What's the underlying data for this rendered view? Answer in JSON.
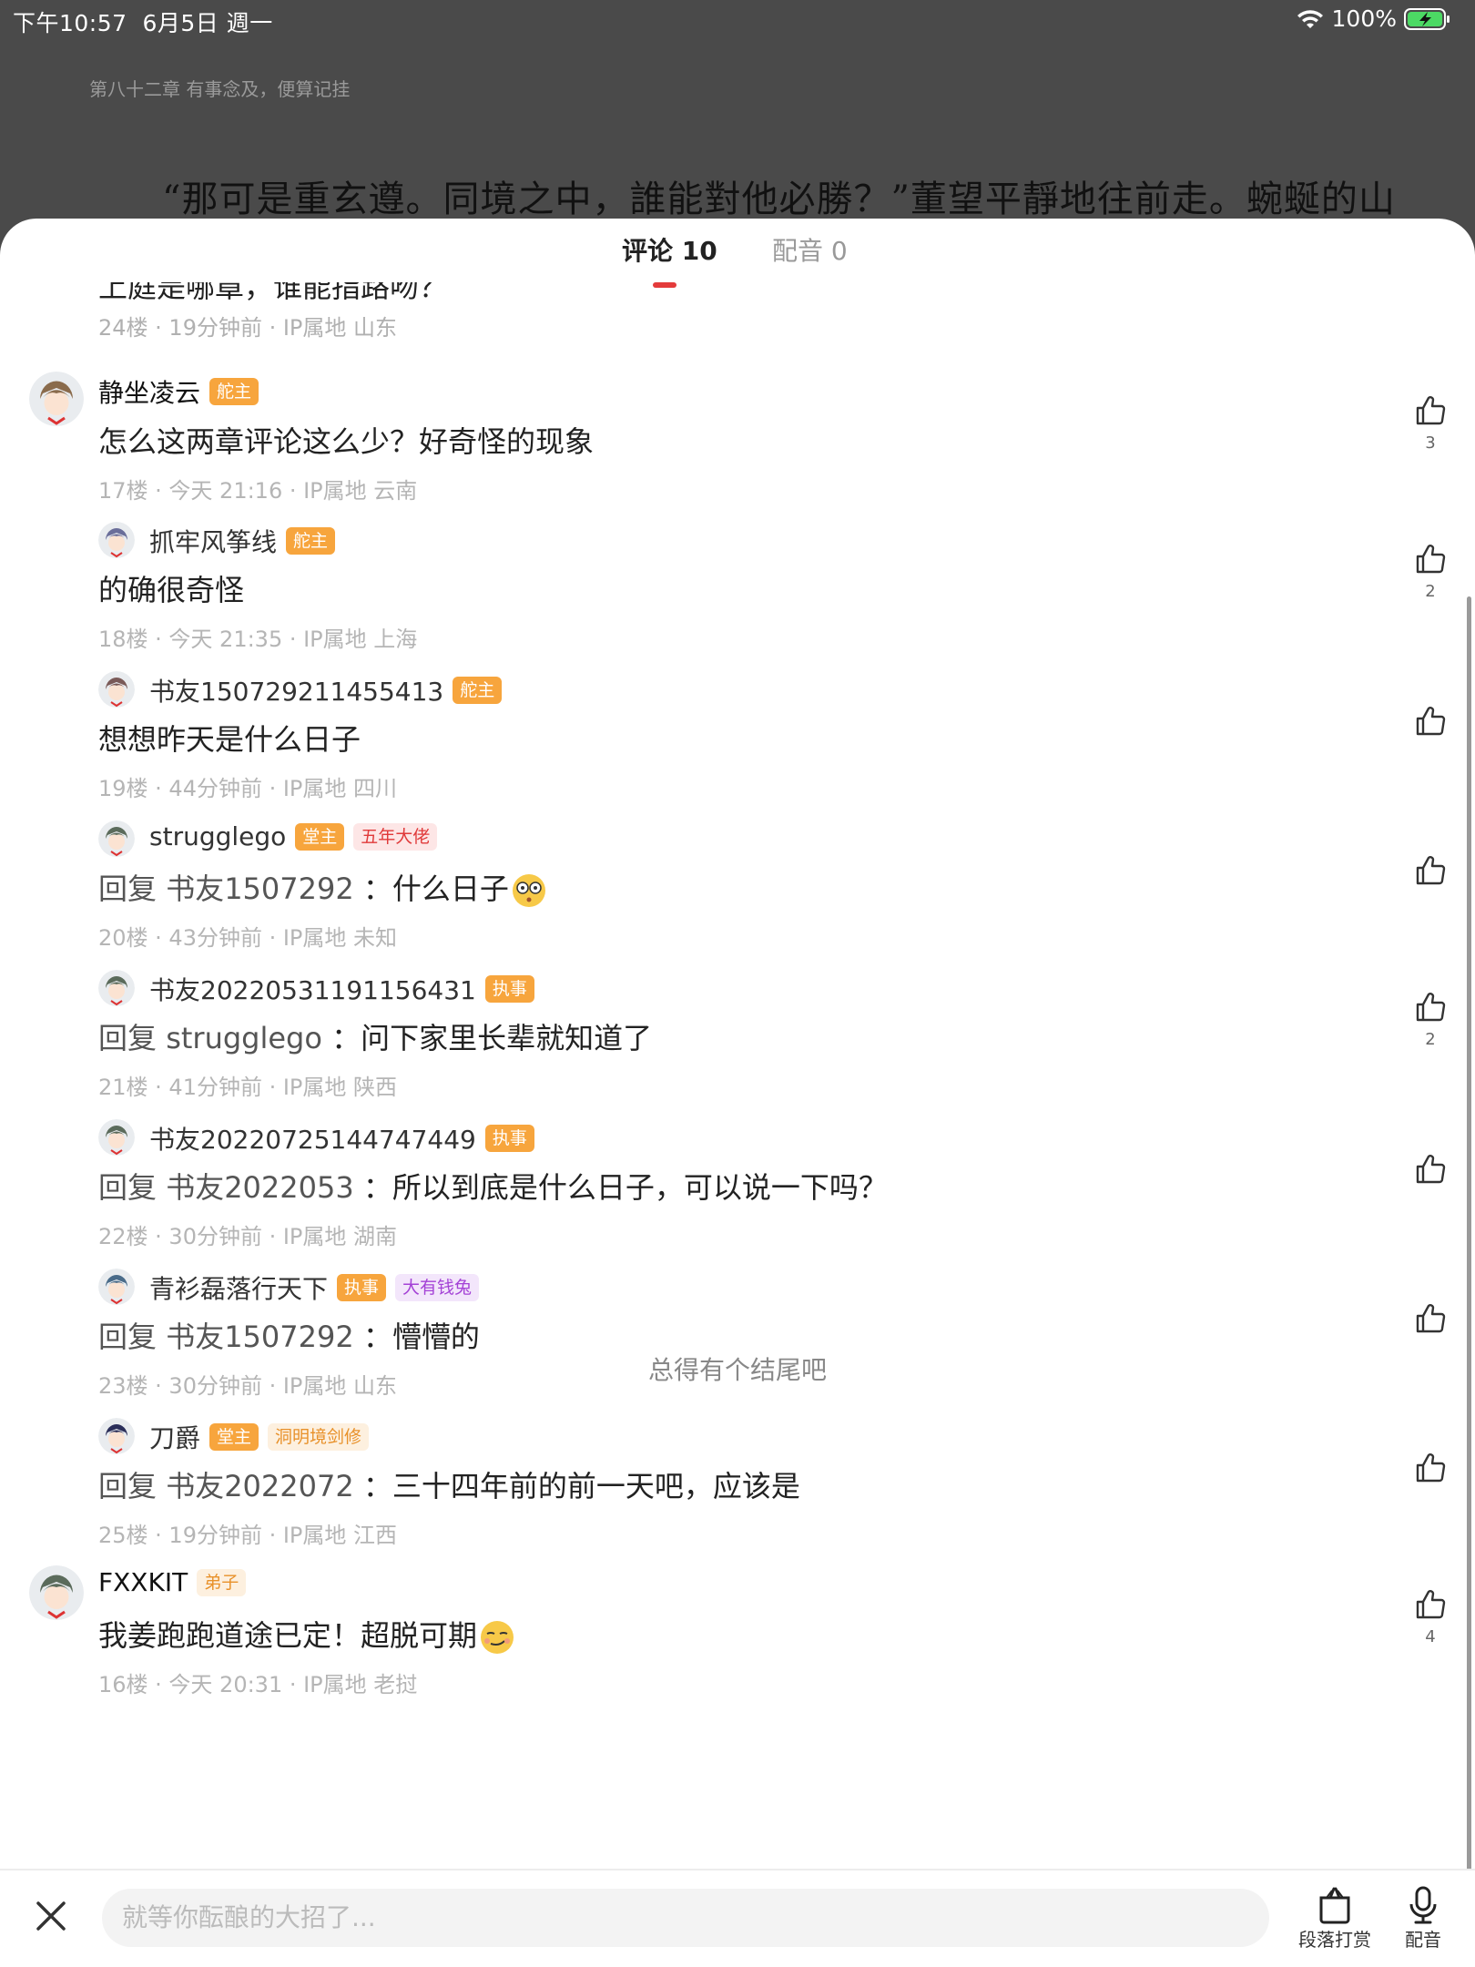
{
  "status_bar": {
    "time": "下午10:57",
    "date": "6月5日 週一",
    "battery": "100%"
  },
  "reader": {
    "chapter_title": "第八十二章 有事念及，便算记挂",
    "text_line": "“那可是重玄遵。同境之中，誰能對他必勝？”董望平靜地往前走。蜿蜒的山"
  },
  "tabs": [
    {
      "label": "评论 10",
      "active": true
    },
    {
      "label": "配音 0",
      "active": false
    }
  ],
  "cut_comment": {
    "text": "上庭是哪章，谁能指路吻？",
    "meta": "24楼 · 19分钟前 · IP属地 山东"
  },
  "comments": [
    {
      "level": "top",
      "name": "静坐凌云",
      "badges": [
        {
          "label": "舵主",
          "style": "orange"
        }
      ],
      "text": "怎么这两章评论这么少？好奇怪的现象",
      "meta": "17楼 · 今天 21:16 · IP属地 云南",
      "likes": "3",
      "avatar_color": "#8a6b4c"
    },
    {
      "level": "reply",
      "name": "抓牢风筝线",
      "badges": [
        {
          "label": "舵主",
          "style": "orange"
        }
      ],
      "text": "的确很奇怪",
      "meta": "18楼 · 今天 21:35 · IP属地 上海",
      "likes": "2",
      "avatar_color": "#6a6e9a"
    },
    {
      "level": "reply",
      "name": "书友150729211455413",
      "badges": [
        {
          "label": "舵主",
          "style": "orange"
        }
      ],
      "text": "想想昨天是什么日子",
      "meta": "19楼 · 44分钟前 · IP属地 四川",
      "likes": "",
      "avatar_color": "#7a5a58"
    },
    {
      "level": "reply",
      "name": "strugglego",
      "badges": [
        {
          "label": "堂主",
          "style": "orange"
        },
        {
          "label": "五年大佬",
          "style": "red"
        }
      ],
      "reply_prefix": "回复",
      "reply_target": "书友1507292",
      "text": "：什么日子",
      "meta": "20楼 · 43分钟前 · IP属地 未知",
      "likes": "",
      "emoji": "shocked-emoji",
      "avatar_color": "#5b6b5b"
    },
    {
      "level": "reply",
      "name": "书友20220531191156431",
      "badges": [
        {
          "label": "执事",
          "style": "orange"
        }
      ],
      "reply_prefix": "回复",
      "reply_target": "strugglego",
      "text": "：问下家里长辈就知道了",
      "meta": "21楼 · 41分钟前 · IP属地 陕西",
      "likes": "2",
      "avatar_color": "#5b6b5b"
    },
    {
      "level": "reply",
      "name": "书友20220725144747449",
      "badges": [
        {
          "label": "执事",
          "style": "orange"
        }
      ],
      "reply_prefix": "回复",
      "reply_target": "书友2022053",
      "text": "：所以到底是什么日子，可以说一下吗？",
      "meta": "22楼 · 30分钟前 · IP属地 湖南",
      "likes": "",
      "avatar_color": "#5b6b5b"
    },
    {
      "level": "reply",
      "name": "青衫磊落行天下",
      "badges": [
        {
          "label": "执事",
          "style": "orange"
        },
        {
          "label": "大有钱兔",
          "style": "purple"
        }
      ],
      "reply_prefix": "回复",
      "reply_target": "书友1507292",
      "text": "：懵懵的",
      "meta": "23楼 · 30分钟前 · IP属地 山东",
      "likes": "",
      "avatar_color": "#4a6c8a"
    },
    {
      "level": "reply",
      "name": "刀爵",
      "badges": [
        {
          "label": "堂主",
          "style": "orange"
        },
        {
          "label": "洞明境剑修",
          "style": "lightorange"
        }
      ],
      "reply_prefix": "回复",
      "reply_target": "书友2022072",
      "text": "：三十四年前的前一天吧，应该是",
      "meta": "25楼 · 19分钟前 · IP属地 江西",
      "likes": "",
      "avatar_color": "#2b2f5a"
    },
    {
      "level": "top",
      "name": "FXXKIT",
      "badges": [
        {
          "label": "弟子",
          "style": "lightorange"
        }
      ],
      "text": "我姜跑跑道途已定！超脱可期",
      "meta": "16楼 · 今天 20:31 · IP属地 老挝",
      "likes": "4",
      "emoji": "smirk-emoji",
      "avatar_color": "#5b6b5b"
    }
  ],
  "end_text": "总得有个结尾吧",
  "bottom_bar": {
    "input_placeholder": "就等你酝酿的大招了...",
    "reward_label": "段落打赏",
    "dub_label": "配音"
  }
}
